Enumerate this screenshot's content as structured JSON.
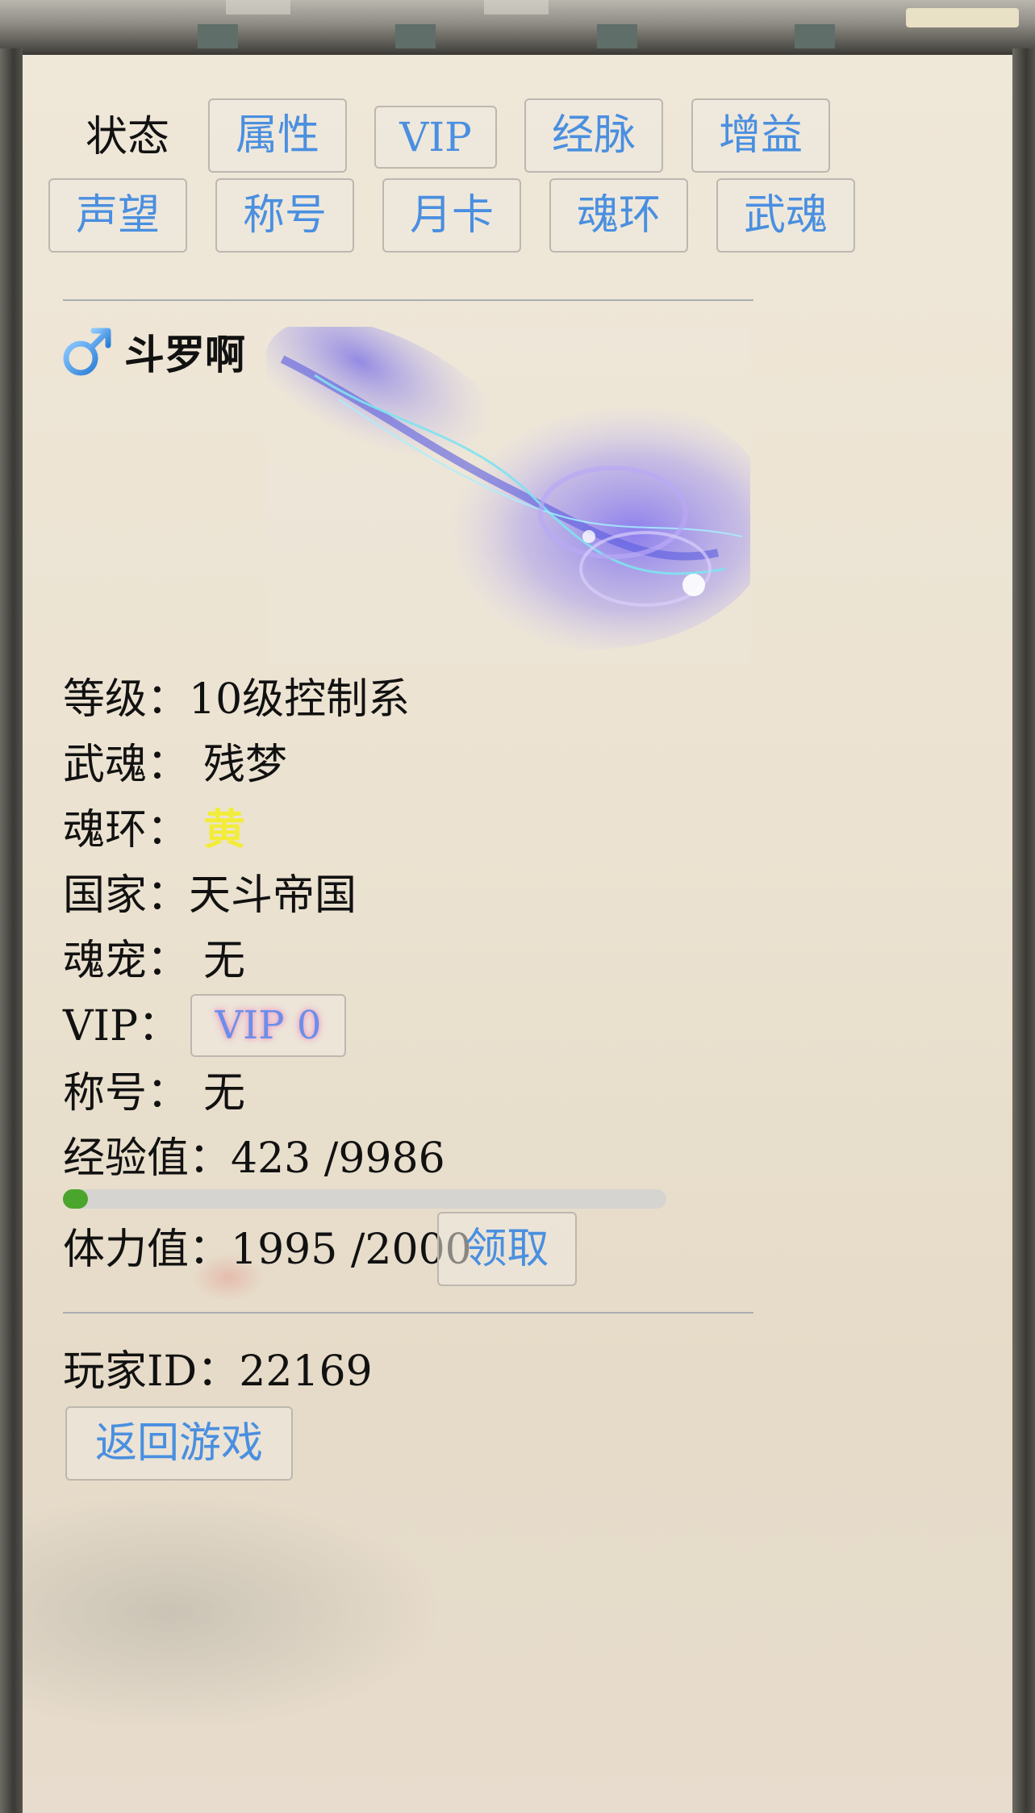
{
  "tabs": {
    "row1": [
      {
        "label": "属性",
        "name": "tab-attributes"
      },
      {
        "label": "VIP",
        "name": "tab-vip"
      },
      {
        "label": "经脉",
        "name": "tab-meridians"
      },
      {
        "label": "增益",
        "name": "tab-buffs"
      }
    ],
    "row2": [
      {
        "label": "声望",
        "name": "tab-reputation"
      },
      {
        "label": "称号",
        "name": "tab-titles"
      },
      {
        "label": "月卡",
        "name": "tab-monthly-card"
      },
      {
        "label": "魂环",
        "name": "tab-soul-rings"
      },
      {
        "label": "武魂",
        "name": "tab-martial-soul"
      }
    ],
    "status_label": "状态"
  },
  "player": {
    "gender_icon": "male-icon",
    "name": "斗罗啊",
    "level_label": "等级：",
    "level_value": "10级控制系",
    "martial_soul_label": "武魂：",
    "martial_soul_value": "残梦",
    "soul_ring_label": "魂环：",
    "soul_ring_value": "黄",
    "soul_ring_color": "#f2ec3a",
    "nation_label": "国家：",
    "nation_value": "天斗帝国",
    "pet_label": "魂宠：",
    "pet_value": "无",
    "vip_label": "VIP：",
    "vip_value": "VIP 0",
    "title_label": "称号：",
    "title_value": "无",
    "exp_label": "经验值：",
    "exp_value": "423 /9986",
    "exp_progress": 0.042,
    "stamina_label": "体力值：",
    "stamina_value": "1995 /2000",
    "claim_button": "领取",
    "id_label": "玩家ID：",
    "id_value": "22169"
  },
  "back_button": "返回游戏",
  "colors": {
    "accent": "#4a8fe0",
    "progress": "#4aa52c",
    "paper": "#ebe2d1"
  }
}
